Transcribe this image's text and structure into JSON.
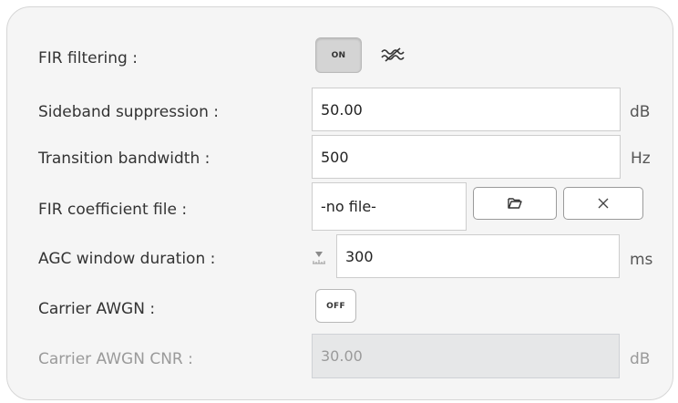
{
  "fir_filtering": {
    "label": "FIR filtering :",
    "toggle_text": "ON",
    "icon": "lowpass-filter-icon"
  },
  "sideband_suppression": {
    "label": "Sideband suppression :",
    "value": "50.00",
    "unit": "dB"
  },
  "transition_bandwidth": {
    "label": "Transition bandwidth :",
    "value": "500",
    "unit": "Hz"
  },
  "fir_coefficient_file": {
    "label": "FIR coefficient file :",
    "value": "-no file-",
    "open_icon": "folder-open-icon",
    "clear_icon": "close-icon"
  },
  "agc_window_duration": {
    "label": "AGC window duration :",
    "value": "300",
    "unit": "ms",
    "icon": "ruler-slider-icon"
  },
  "carrier_awgn": {
    "label": "Carrier AWGN :",
    "toggle_text": "OFF"
  },
  "carrier_awgn_cnr": {
    "label": "Carrier AWGN CNR :",
    "value": "30.00",
    "unit": "dB",
    "disabled": true
  }
}
